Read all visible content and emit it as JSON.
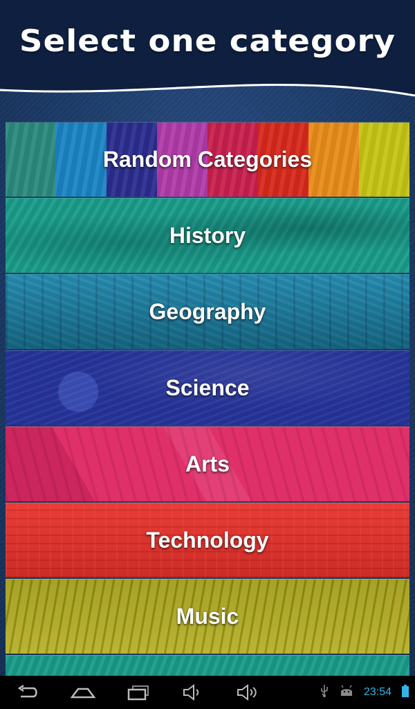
{
  "header": {
    "title": "Select one category"
  },
  "categories": [
    {
      "id": "random",
      "label": "Random Categories",
      "color": "#2a8a7c"
    },
    {
      "id": "history",
      "label": "History",
      "color": "#1a9c8a"
    },
    {
      "id": "geography",
      "label": "Geography",
      "color": "#1a84aa"
    },
    {
      "id": "science",
      "label": "Science",
      "color": "#26349a"
    },
    {
      "id": "arts",
      "label": "Arts",
      "color": "#e0306a"
    },
    {
      "id": "technology",
      "label": "Technology",
      "color": "#e8322c"
    },
    {
      "id": "music",
      "label": "Music",
      "color": "#a9a30f"
    },
    {
      "id": "next",
      "label": "",
      "color": "#1a9c8a"
    }
  ],
  "random_stripe_colors": [
    "#2a8a7c",
    "#1a84c4",
    "#2a2d8e",
    "#b03aa8",
    "#c8204e",
    "#d8281c",
    "#e88c1a",
    "#c6c414"
  ],
  "status_bar": {
    "clock": "23:54",
    "icons": [
      "back-icon",
      "home-icon",
      "recent-apps-icon",
      "volume-down-icon",
      "volume-up-icon",
      "usb-icon",
      "android-debug-icon",
      "battery-icon"
    ]
  },
  "colors": {
    "header_bg": "#0e1f40",
    "clock": "#33b5e5"
  }
}
